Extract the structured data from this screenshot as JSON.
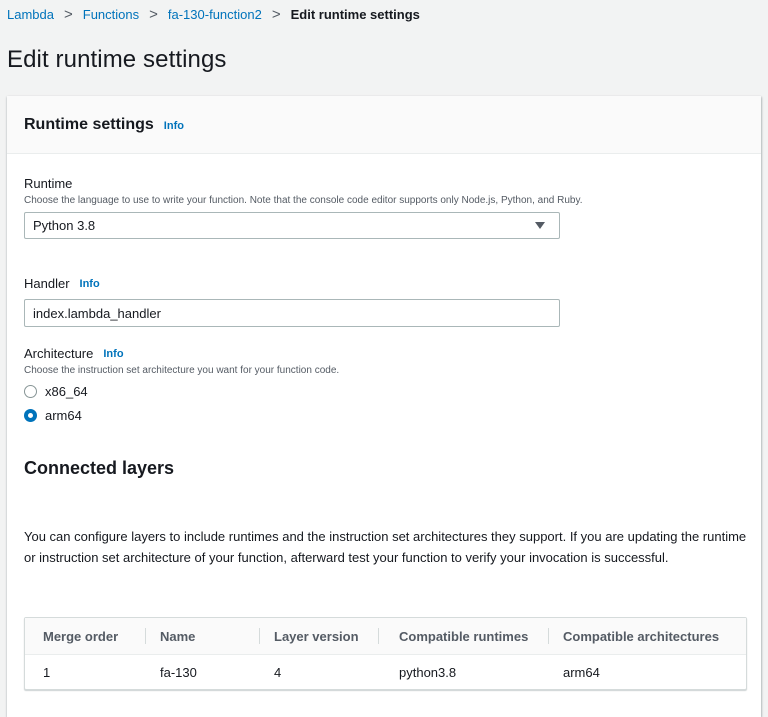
{
  "breadcrumb": {
    "items": [
      "Lambda",
      "Functions",
      "fa-130-function2"
    ],
    "current": "Edit runtime settings",
    "separator": ">"
  },
  "page": {
    "title": "Edit runtime settings"
  },
  "runtime_settings": {
    "title": "Runtime settings",
    "info": "Info",
    "runtime": {
      "label": "Runtime",
      "description": "Choose the language to use to write your function. Note that the console code editor supports only Node.js, Python, and Ruby.",
      "value": "Python 3.8"
    },
    "handler": {
      "label": "Handler",
      "info": "Info",
      "value": "index.lambda_handler"
    },
    "architecture": {
      "label": "Architecture",
      "info": "Info",
      "description": "Choose the instruction set architecture you want for your function code.",
      "options": [
        "x86_64",
        "arm64"
      ],
      "selected": "arm64"
    }
  },
  "connected_layers": {
    "title": "Connected layers",
    "description": "You can configure layers to include runtimes and the instruction set architectures they support. If you are updating the runtime or instruction set architecture of your function, afterward test your function to verify your invocation is successful.",
    "columns": [
      "Merge order",
      "Name",
      "Layer version",
      "Compatible runtimes",
      "Compatible architectures"
    ],
    "rows": [
      [
        "1",
        "fa-130",
        "4",
        "python3.8",
        "arm64"
      ]
    ]
  },
  "colors": {
    "link": "#0073bb",
    "background": "#f2f3f3",
    "text": "#16191f",
    "muted": "#545b64"
  }
}
